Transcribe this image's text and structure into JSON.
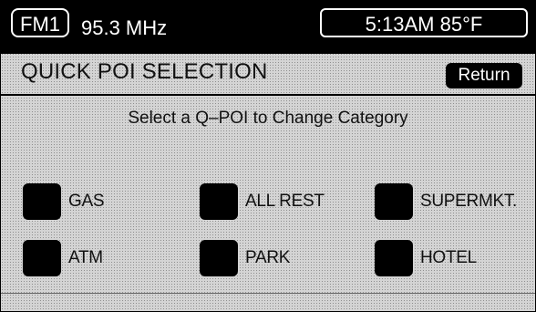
{
  "status_bar": {
    "band": "FM1",
    "frequency": "95.3 MHz",
    "clock": "5:13AM 85°F"
  },
  "header": {
    "title": "QUICK POI SELECTION",
    "return_label": "Return"
  },
  "instruction": "Select a Q–POI to Change Category",
  "poi_buttons": [
    {
      "label": "GAS"
    },
    {
      "label": "ALL REST"
    },
    {
      "label": "SUPERMKT."
    },
    {
      "label": "ATM"
    },
    {
      "label": "PARK"
    },
    {
      "label": "HOTEL"
    }
  ]
}
